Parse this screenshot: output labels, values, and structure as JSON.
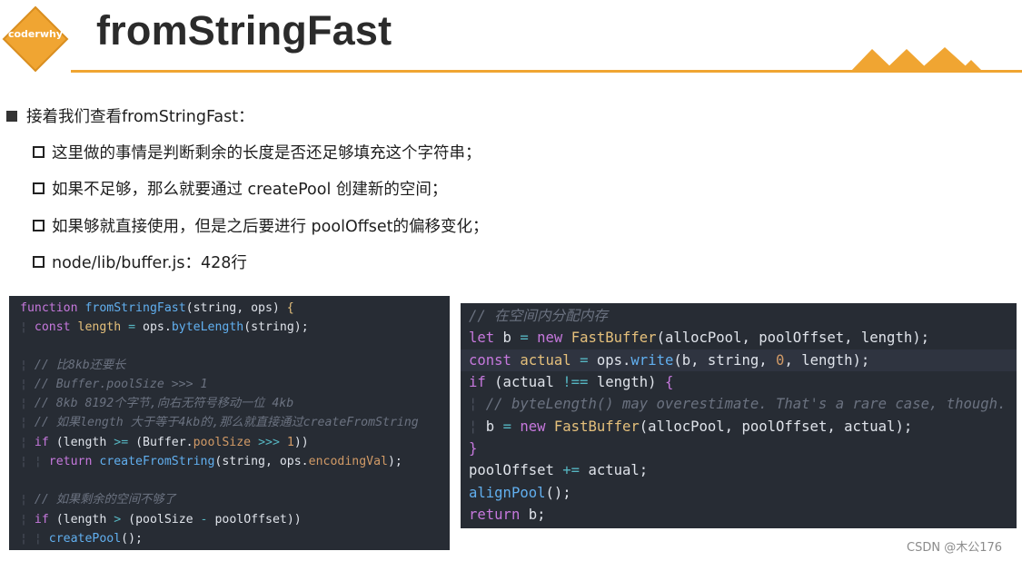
{
  "header": {
    "logo_text": "coderwhy",
    "title": "fromStringFast"
  },
  "colors": {
    "accent": "#f0a532",
    "code_bg": "#272c34",
    "keyword": "#c678dd",
    "function": "#61afef",
    "variable": "#e5c07b",
    "comment": "#6b7280"
  },
  "bullets": {
    "main": "接着我们查看fromStringFast：",
    "sub": [
      "这里做的事情是判断剩余的长度是否还足够填充这个字符串；",
      "如果不足够，那么就要通过 createPool 创建新的空间；",
      "如果够就直接使用，但是之后要进行 poolOffset的偏移变化；",
      "node/lib/buffer.js：428行"
    ]
  },
  "code_left": {
    "l1": {
      "kw": "function",
      "fn": "fromStringFast",
      "p1": "(string, ops) ",
      "brace": "{"
    },
    "l2": {
      "kw": "const",
      "vr": "length",
      "op": "=",
      "obj": "ops.",
      "fn": "byteLength",
      "args": "(string);"
    },
    "l4": "// 比8kb还要长",
    "l5": "// Buffer.poolSize >>> 1",
    "l6": "// 8kb 8192个字节,向右无符号移动一位 4kb",
    "l7": "// 如果length 大于等于4kb的,那么就直接通过createFromString",
    "l8": {
      "kw": "if",
      "p1": " (length ",
      "op1": ">=",
      "p2": " (Buffer.",
      "prop": "poolSize",
      "op2": ">>>",
      "num": "1",
      "p3": "))"
    },
    "l9": {
      "kw": "return",
      "fn": "createFromString",
      "p1": "(string, ops.",
      "prop": "encodingVal",
      "p2": ");"
    },
    "l11": "// 如果剩余的空间不够了",
    "l12": {
      "kw": "if",
      "p1": " (length ",
      "op1": ">",
      "p2": " (poolSize ",
      "op2": "-",
      "p3": " poolOffset))"
    },
    "l13": {
      "fn": "createPool",
      "p1": "();"
    }
  },
  "code_right": {
    "r1": "// 在空间内分配内存",
    "r2": {
      "kw": "let",
      "v": " b ",
      "op": "=",
      "kw2": "new",
      "cls": "FastBuffer",
      "p": "(allocPool, poolOffset, length);"
    },
    "r3": {
      "kw": "const",
      "vr": "actual",
      "op": "=",
      "obj": " ops.",
      "fn": "write",
      "p1": "(b, string, ",
      "num": "0",
      "p2": ", length);"
    },
    "r4": {
      "kw": "if",
      "p1": " (actual ",
      "op": "!==",
      "p2": " length) ",
      "brace": "{"
    },
    "r5": "// byteLength() may overestimate. That's a rare case, though.",
    "r6": {
      "v": "b ",
      "op": "=",
      "kw2": "new",
      "cls": "FastBuffer",
      "p": "(allocPool, poolOffset, actual);"
    },
    "r7": "}",
    "r8": {
      "v": "poolOffset ",
      "op": "+=",
      "p": " actual;"
    },
    "r9": {
      "fn": "alignPool",
      "p": "();"
    },
    "r10": {
      "kw": "return",
      "p": " b;"
    }
  },
  "footer": {
    "watermark": "CSDN @木公176"
  }
}
